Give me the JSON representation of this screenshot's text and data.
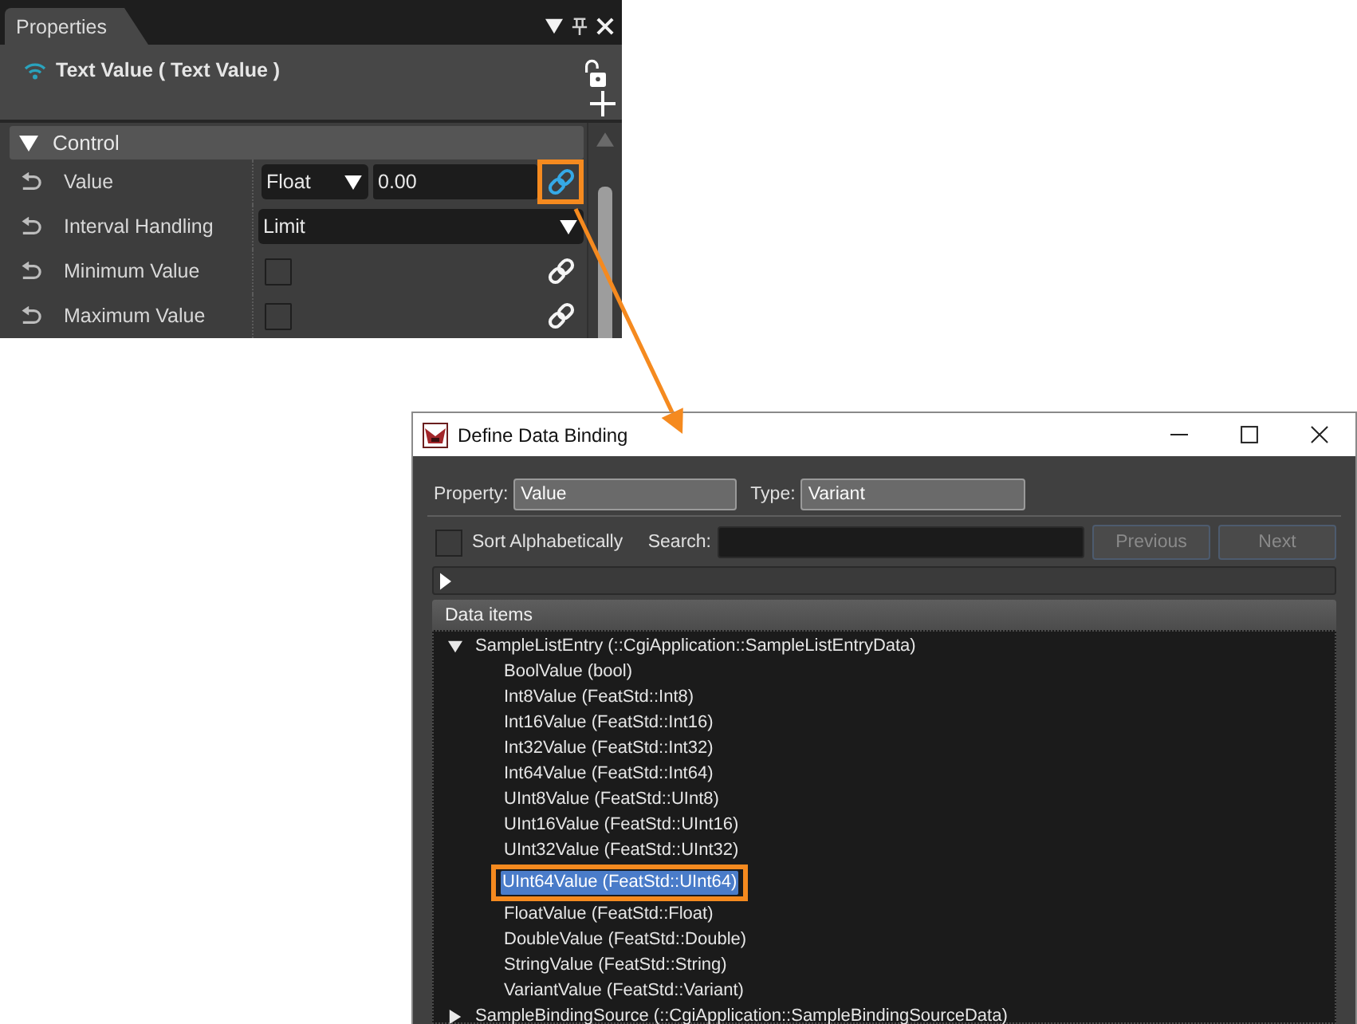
{
  "properties_panel": {
    "tab": {
      "label": "Properties",
      "selected": true
    },
    "header": {
      "title": "Text Value ( Text Value )"
    },
    "section": {
      "title": "Control",
      "expanded": true
    },
    "rows": [
      {
        "kind": "type_value",
        "label": "Value",
        "type": "Float",
        "value": "0.00",
        "bound": true,
        "highlighted": true
      },
      {
        "kind": "dropdown",
        "label": "Interval Handling",
        "value": "Limit"
      },
      {
        "kind": "checkbox",
        "label": "Minimum Value",
        "checked": false,
        "bound": false,
        "highlighted": false
      },
      {
        "kind": "checkbox",
        "label": "Maximum Value",
        "checked": false,
        "bound": false,
        "highlighted": false
      }
    ]
  },
  "dialog": {
    "title": "Define Data Binding",
    "property": {
      "label": "Property:",
      "value": "Value"
    },
    "type": {
      "label": "Type:",
      "value": "Variant"
    },
    "sort_alphabetically": {
      "label": "Sort Alphabetically",
      "checked": false
    },
    "search": {
      "label": "Search:"
    },
    "buttons": [
      {
        "label": "Previous",
        "disabled": true
      },
      {
        "label": "Next",
        "disabled": true
      }
    ],
    "path_bar": {
      "expanded": false
    },
    "data_items": {
      "title": "Data items",
      "tree": [
        {
          "label": "SampleListEntry (::CgiApplication::SampleListEntryData)",
          "expanded": true,
          "selected": false,
          "children": [
            {
              "label": "BoolValue (bool)",
              "selected": false,
              "highlighted": false
            },
            {
              "label": "Int8Value (FeatStd::Int8)",
              "selected": false,
              "highlighted": false
            },
            {
              "label": "Int16Value (FeatStd::Int16)",
              "selected": false,
              "highlighted": false
            },
            {
              "label": "Int32Value (FeatStd::Int32)",
              "selected": false,
              "highlighted": false
            },
            {
              "label": "Int64Value (FeatStd::Int64)",
              "selected": false,
              "highlighted": false
            },
            {
              "label": "UInt8Value (FeatStd::UInt8)",
              "selected": false,
              "highlighted": false
            },
            {
              "label": "UInt16Value (FeatStd::UInt16)",
              "selected": false,
              "highlighted": false
            },
            {
              "label": "UInt32Value (FeatStd::UInt32)",
              "selected": false,
              "highlighted": false
            },
            {
              "label": "UInt64Value (FeatStd::UInt64)",
              "selected": true,
              "highlighted": true
            },
            {
              "label": "FloatValue (FeatStd::Float)",
              "selected": false,
              "highlighted": false
            },
            {
              "label": "DoubleValue (FeatStd::Double)",
              "selected": false,
              "highlighted": false
            },
            {
              "label": "StringValue (FeatStd::String)",
              "selected": false,
              "highlighted": false
            },
            {
              "label": "VariantValue (FeatStd::Variant)",
              "selected": false,
              "highlighted": false
            }
          ]
        },
        {
          "label": "SampleBindingSource (::CgiApplication::SampleBindingSourceData)",
          "expanded": false,
          "selected": false
        }
      ]
    }
  }
}
